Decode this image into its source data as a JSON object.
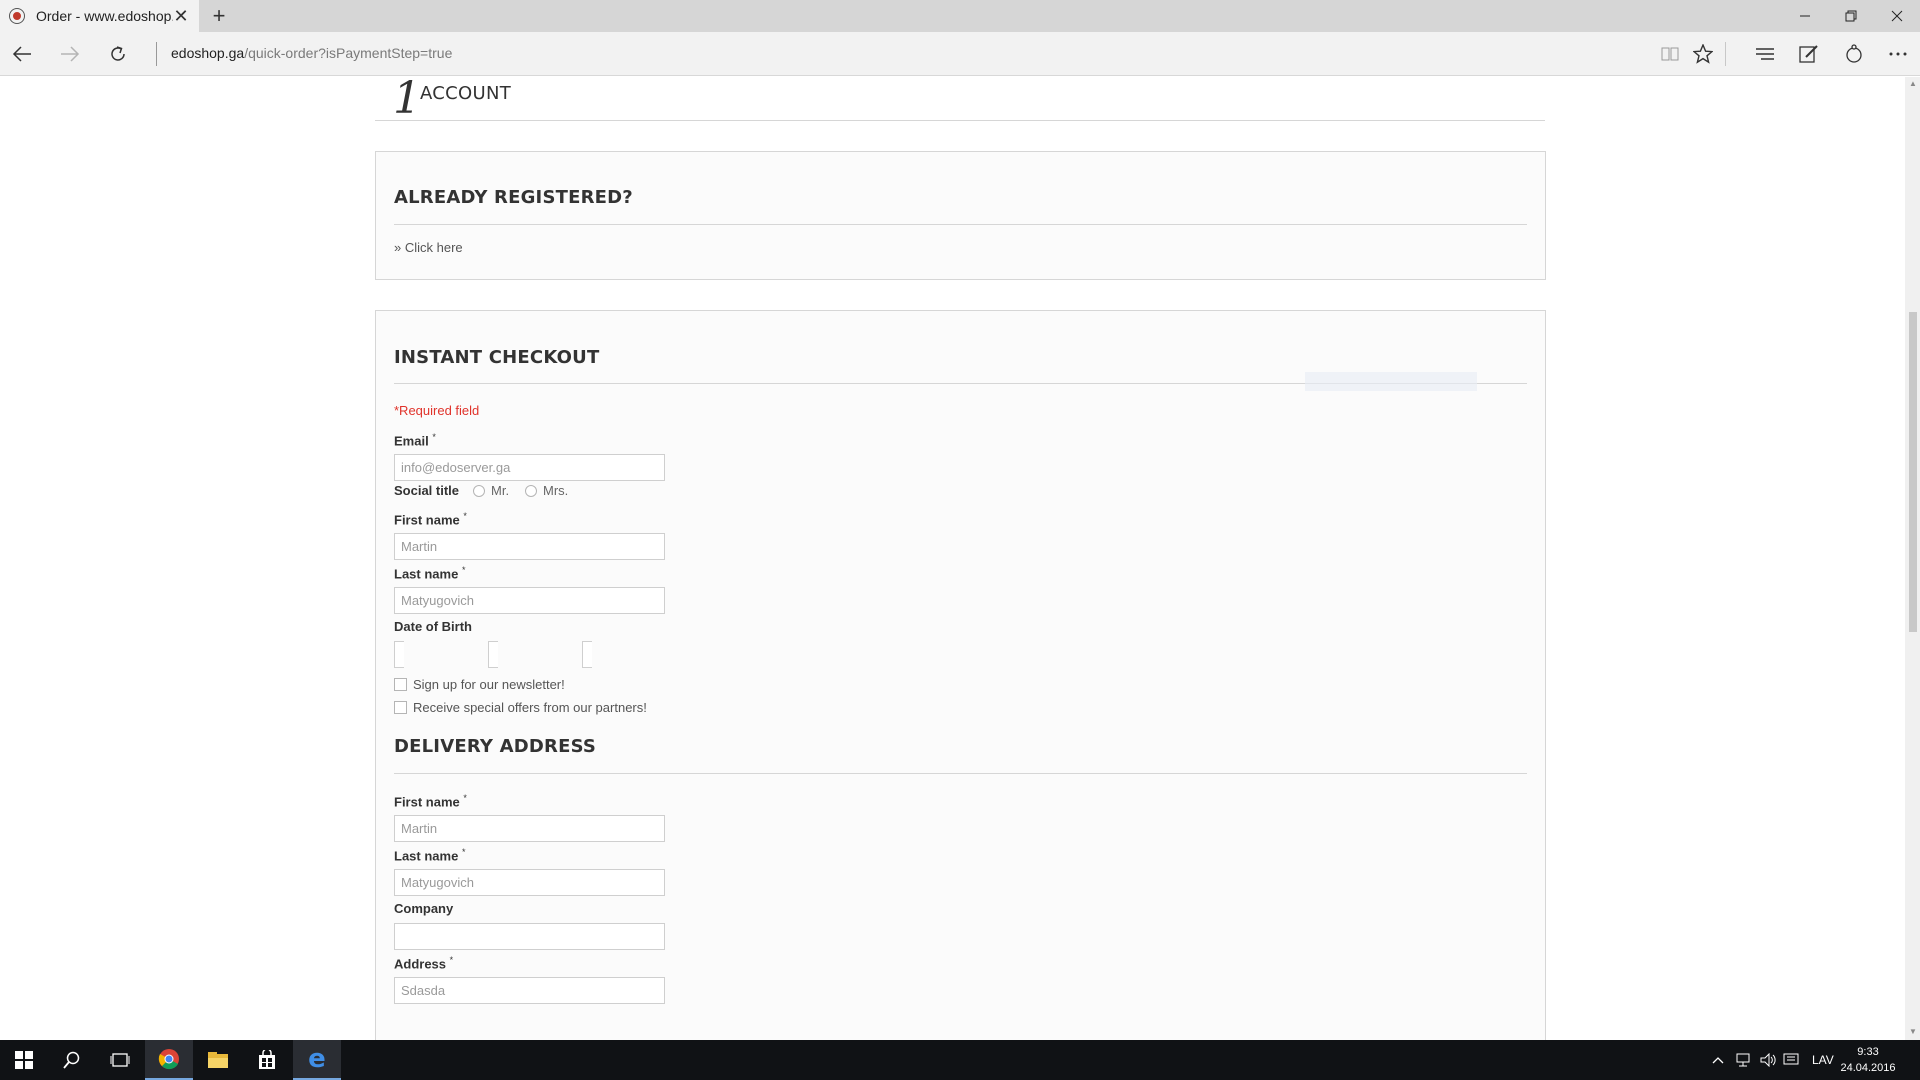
{
  "browser": {
    "tab_title": "Order - www.edoshop.ga",
    "url_host": "edoshop.ga",
    "url_path": "/quick-order?isPaymentStep=true"
  },
  "page": {
    "step": {
      "number": "1",
      "title": "ACCOUNT"
    },
    "registered": {
      "title": "ALREADY REGISTERED?",
      "link": "» Click here"
    },
    "checkout": {
      "title": "INSTANT CHECKOUT",
      "required_note": "*Required field",
      "email_label": "Email",
      "email_value": "info@edoserver.ga",
      "social_title_label": "Social title",
      "social_options": [
        "Mr.",
        "Mrs."
      ],
      "first_name_label": "First name",
      "first_name_value": "Martin",
      "last_name_label": "Last name",
      "last_name_value": "Matyugovich",
      "dob_label": "Date of Birth",
      "newsletter_label": "Sign up for our newsletter!",
      "offers_label": "Receive special offers from our partners!"
    },
    "delivery": {
      "title": "DELIVERY ADDRESS",
      "first_name_label": "First name",
      "first_name_value": "Martin",
      "last_name_label": "Last name",
      "last_name_value": "Matyugovich",
      "company_label": "Company",
      "company_value": "",
      "address_label": "Address",
      "address_value": "Sdasda"
    },
    "required_mark": "*"
  },
  "taskbar": {
    "language": "LAV",
    "time": "9:33",
    "date": "24.04.2016"
  },
  "colors": {
    "required": "#e0332b",
    "text": "#333333",
    "border": "#d6d6d6"
  }
}
